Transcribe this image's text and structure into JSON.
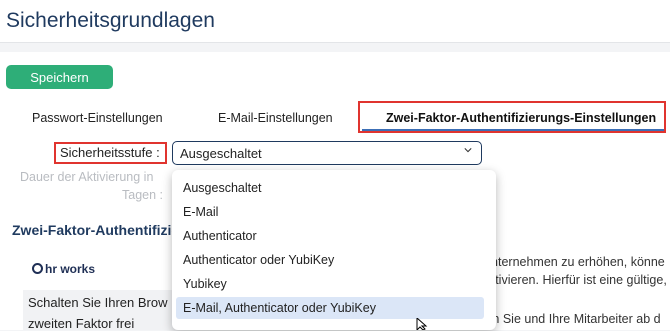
{
  "page": {
    "title": "Sicherheitsgrundlagen"
  },
  "toolbar": {
    "save_label": "Speichern"
  },
  "tabs": [
    {
      "label": "Passwort-Einstellungen"
    },
    {
      "label": "E-Mail-Einstellungen"
    },
    {
      "label": "Zwei-Faktor-Authentifizierungs-Einstellungen",
      "active": true
    }
  ],
  "form": {
    "security_level_label": "Sicherheitsstufe :",
    "security_level_value": "Ausgeschaltet",
    "activation_label_line1": "Dauer der Aktivierung in",
    "activation_label_line2": "Tagen :"
  },
  "dropdown": {
    "options": [
      "Ausgeschaltet",
      "E-Mail",
      "Authenticator",
      "Authenticator oder YubiKey",
      "Yubikey",
      "E-Mail, Authenticator oder YubiKey"
    ],
    "highlighted_index": 5
  },
  "section": {
    "title": "Zwei-Faktor-Authentifizie",
    "logo_text": "hr works",
    "info_line1": "Schalten Sie Ihren Brow",
    "info_line2": "zweiten Faktor frei",
    "right_line1": "Unternehmen zu erhöhen, könne",
    "right_line2": "aktivieren. Hierfür ist eine gültige,",
    "right_line3": "ten Sie und Ihre Mitarbeiter ab d"
  },
  "colors": {
    "brand_navy": "#1f3a5f",
    "save_green": "#2eae78",
    "highlight_red": "#e0342f",
    "tab_underline": "#3c6fb6",
    "selected_option": "#dbe6f7"
  }
}
